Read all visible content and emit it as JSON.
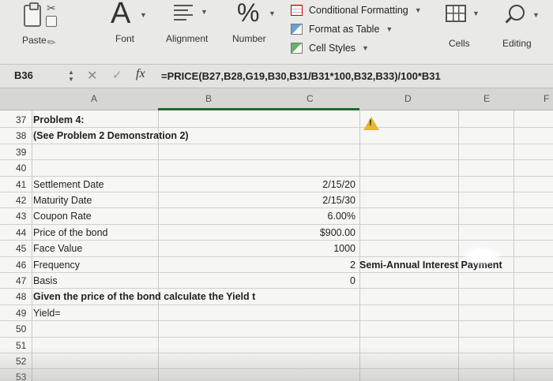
{
  "ribbon": {
    "paste_label": "Paste",
    "font_label": "Font",
    "font_glyph": "A",
    "alignment_label": "Alignment",
    "number_label": "Number",
    "number_glyph": "%",
    "conditional_formatting": "Conditional Formatting",
    "format_as_table": "Format as Table",
    "cell_styles": "Cell Styles",
    "cells_label": "Cells",
    "editing_label": "Editing"
  },
  "formula_bar": {
    "name_box": "B36",
    "fx_glyph": "fx",
    "formula": "=PRICE(B27,B28,G19,B30,B31/B31*100,B32,B33)/100*B31"
  },
  "columns": [
    "A",
    "B",
    "C",
    "D",
    "E",
    "F"
  ],
  "rows": [
    {
      "num": "37",
      "label": "Problem 4:",
      "bold": true,
      "value": "",
      "note": ""
    },
    {
      "num": "38",
      "label": "(See Problem 2 Demonstration 2)",
      "bold": true,
      "value": "",
      "note": ""
    },
    {
      "num": "39",
      "label": "",
      "bold": false,
      "value": "",
      "note": ""
    },
    {
      "num": "40",
      "label": "",
      "bold": false,
      "value": "",
      "note": ""
    },
    {
      "num": "41",
      "label": "Settlement Date",
      "bold": false,
      "value": "2/15/20",
      "note": ""
    },
    {
      "num": "42",
      "label": "Maturity Date",
      "bold": false,
      "value": "2/15/30",
      "note": ""
    },
    {
      "num": "43",
      "label": "Coupon Rate",
      "bold": false,
      "value": "6.00%",
      "note": ""
    },
    {
      "num": "44",
      "label": "Price of the bond",
      "bold": false,
      "value": "$900.00",
      "note": ""
    },
    {
      "num": "45",
      "label": "Face Value",
      "bold": false,
      "value": "1000",
      "note": ""
    },
    {
      "num": "46",
      "label": "Frequency",
      "bold": false,
      "value": "2",
      "note": "Semi-Annual Interest Payment"
    },
    {
      "num": "47",
      "label": "Basis",
      "bold": false,
      "value": "0",
      "note": ""
    },
    {
      "num": "48",
      "label": "Given the price of the bond calculate the Yield t",
      "bold": true,
      "value": "",
      "note": ""
    },
    {
      "num": "49",
      "label": "Yield=",
      "bold": false,
      "value": "",
      "note": ""
    },
    {
      "num": "50",
      "label": "",
      "bold": false,
      "value": "",
      "note": ""
    },
    {
      "num": "51",
      "label": "",
      "bold": false,
      "value": "",
      "note": ""
    },
    {
      "num": "52",
      "label": "",
      "bold": false,
      "value": "",
      "note": ""
    },
    {
      "num": "53",
      "label": "",
      "bold": false,
      "value": "",
      "note": ""
    }
  ],
  "colors": {
    "selection": "#1e6b2f",
    "warning": "#e8b731"
  }
}
